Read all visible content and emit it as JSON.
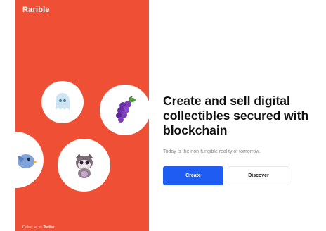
{
  "brand": {
    "name": "Rarible"
  },
  "hero": {
    "headline": "Create and sell digital collectibles secured with blockchain",
    "tagline": "Today is the non-fungible reality of tomorrow."
  },
  "actions": {
    "create_label": "Create",
    "discover_label": "Discover"
  },
  "footer": {
    "prefix": "Follow us on",
    "link": "Twitter"
  },
  "colors": {
    "panel": "#ef4f34",
    "primary": "#1f5cf2"
  },
  "icons": [
    "ghost-sticker-icon",
    "grapes-icon",
    "bird-sticker-icon",
    "cat-sticker-icon"
  ]
}
